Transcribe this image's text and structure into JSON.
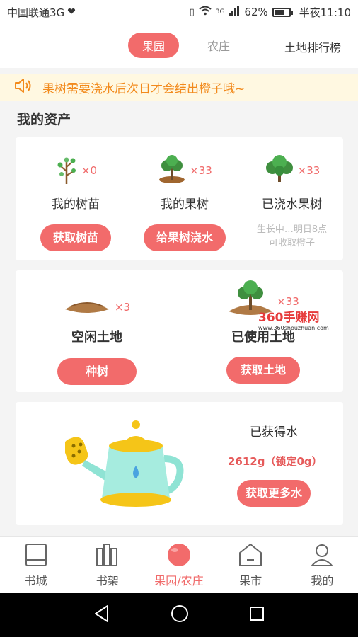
{
  "status": {
    "carrier": "中国联通3G",
    "network": "3G",
    "battery": "62%",
    "time": "半夜11:10"
  },
  "nav": {
    "tabs": [
      "果园",
      "农庄"
    ],
    "active_tab": "果园",
    "rank": "土地排行榜"
  },
  "notice": "果树需要浇水后次日才会结出橙子哦~",
  "section_title": "我的资产",
  "assets": [
    {
      "label": "我的树苗",
      "count": "×0",
      "button": "获取树苗"
    },
    {
      "label": "我的果树",
      "count": "×33",
      "button": "给果树浇水"
    },
    {
      "label": "已浇水果树",
      "count": "×33",
      "hint_line1": "生长中…明日8点",
      "hint_line2": "可收取橙子"
    }
  ],
  "land": [
    {
      "label": "空闲土地",
      "count": "×3",
      "button": "种树"
    },
    {
      "label": "已使用土地",
      "count": "×33",
      "button": "获取土地"
    }
  ],
  "water": {
    "title": "已获得水",
    "amount": "2612g（锁定0g）",
    "button": "获取更多水"
  },
  "watermark": {
    "brand": "360手赚网",
    "url": "www.360shouzhuan.com"
  },
  "tabbar": [
    {
      "label": "书城",
      "icon": "book-icon"
    },
    {
      "label": "书架",
      "icon": "bookshelf-icon"
    },
    {
      "label": "果园/农庄",
      "icon": "fruit-icon",
      "active": true
    },
    {
      "label": "果市",
      "icon": "market-icon"
    },
    {
      "label": "我的",
      "icon": "profile-icon"
    }
  ],
  "colors": {
    "accent": "#f26b6b",
    "notice_text": "#f28a1c",
    "notice_bg": "#fff8e1"
  }
}
